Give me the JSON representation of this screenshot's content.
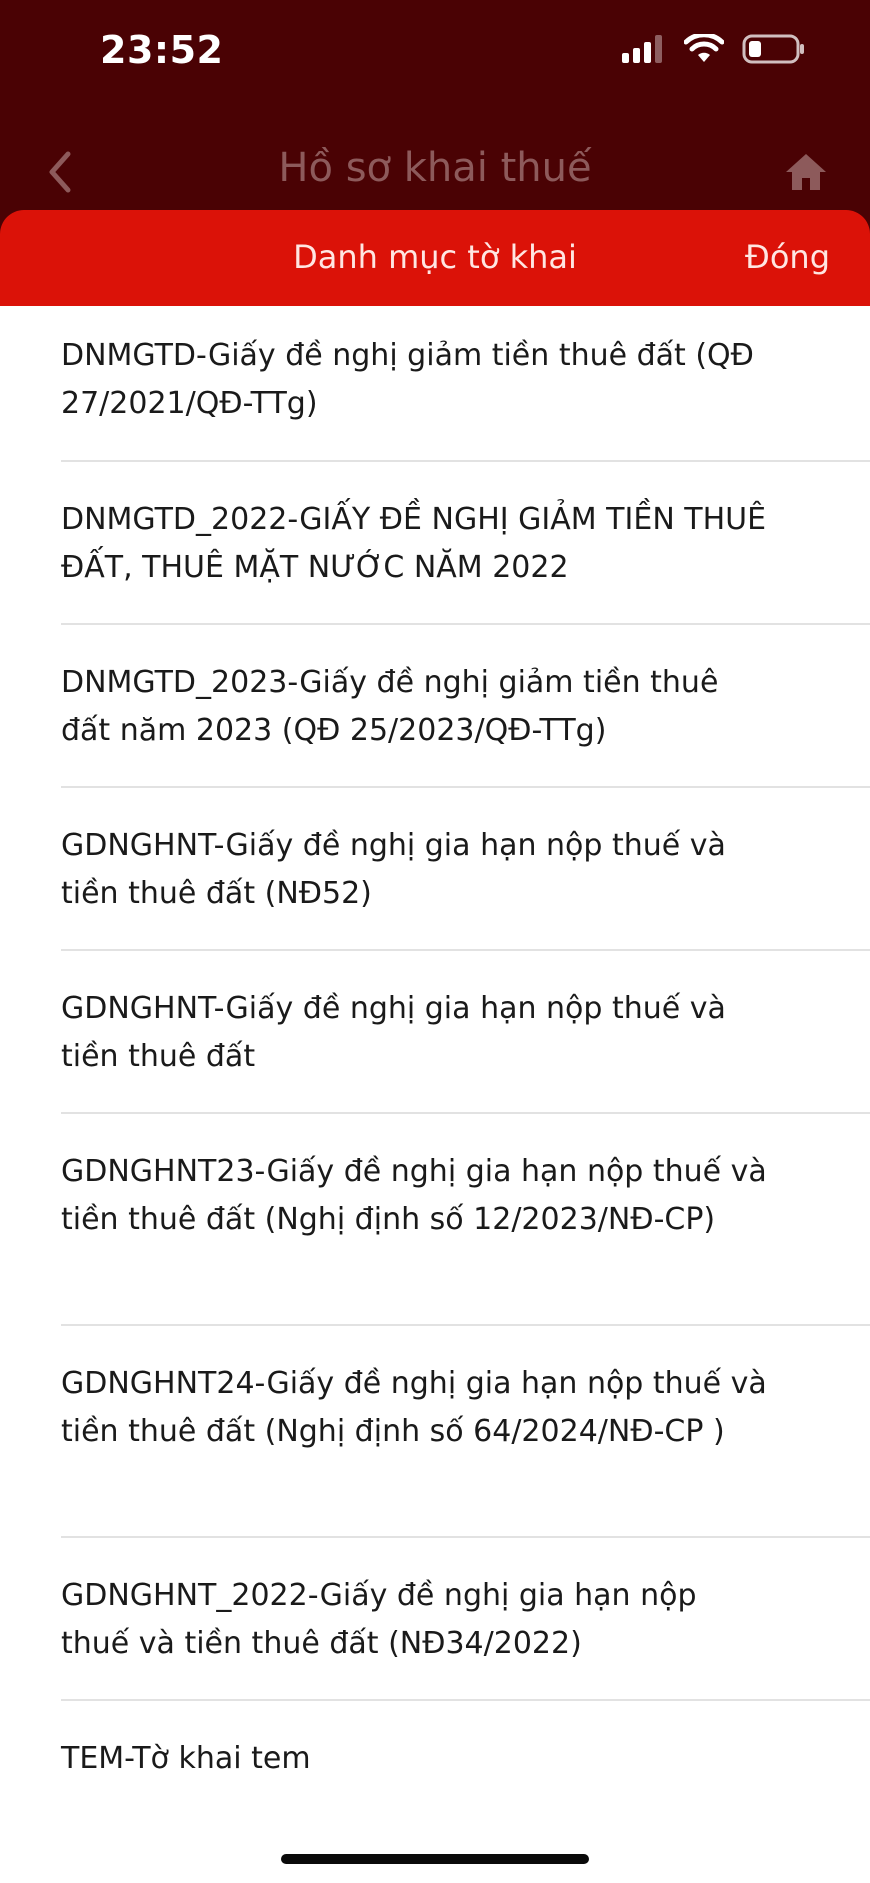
{
  "status_bar": {
    "time": "23:52"
  },
  "nav": {
    "title": "Hồ sơ khai thuế",
    "back_icon": "chevron-left-icon",
    "home_icon": "home-icon"
  },
  "sheet": {
    "title": "Danh mục tờ khai",
    "close_label": "Đóng"
  },
  "colors": {
    "header_dark": "#4a0204",
    "sheet_red": "#db1208",
    "title_muted": "#8d5a5b"
  },
  "items": [
    {
      "label": "DNMGTD-Giấy đề nghị giảm tiền thuê đất (QĐ 27/2021/QĐ-TTg)"
    },
    {
      "label": "DNMGTD_2022-GIẤY ĐỀ NGHỊ GIẢM TIỀN THUÊ ĐẤT, THUÊ MẶT NƯỚC NĂM 2022"
    },
    {
      "label": "DNMGTD_2023-Giấy đề nghị giảm tiền thuê đất năm 2023 (QĐ 25/2023/QĐ-TTg)"
    },
    {
      "label": "GDNGHNT-Giấy đề nghị gia hạn nộp thuế và tiền thuê đất (NĐ52)"
    },
    {
      "label": "GDNGHNT-Giấy đề nghị gia hạn nộp thuế và tiền thuê đất"
    },
    {
      "label": "GDNGHNT23-Giấy đề nghị gia hạn nộp thuế và tiền thuê đất (Nghị định số 12/2023/NĐ-CP)"
    },
    {
      "label": "GDNGHNT24-Giấy đề nghị gia hạn nộp thuế và tiền thuê đất (Nghị định số 64/2024/NĐ-CP )"
    },
    {
      "label": "GDNGHNT_2022-Giấy đề nghị gia hạn nộp thuế và tiền thuê đất (NĐ34/2022)"
    },
    {
      "label": "TEM-Tờ khai tem"
    }
  ]
}
